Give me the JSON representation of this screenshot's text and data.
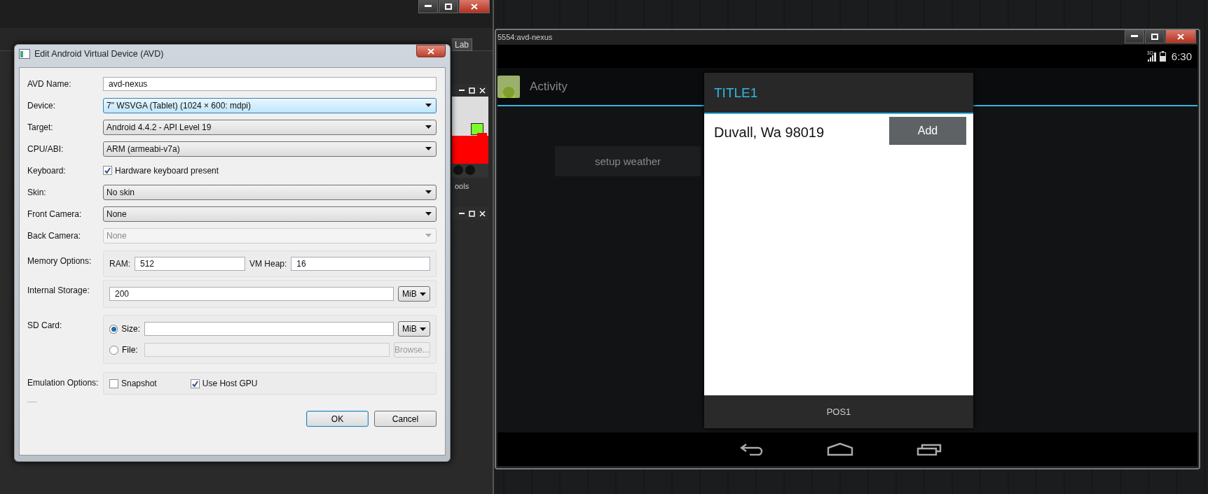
{
  "background_window": {
    "toolbar_button": "Lab",
    "panel_label": "ools"
  },
  "avd_dialog": {
    "title": "Edit Android Virtual Device (AVD)",
    "rows": [
      {
        "kind": "text",
        "label": "AVD Name:",
        "value": "avd-nexus"
      },
      {
        "kind": "select",
        "label": "Device:",
        "value": "7\" WSVGA (Tablet) (1024 × 600: mdpi)",
        "highlighted": true,
        "disabled": false
      },
      {
        "kind": "select",
        "label": "Target:",
        "value": "Android 4.4.2 - API Level 19",
        "highlighted": false,
        "disabled": false
      },
      {
        "kind": "select",
        "label": "CPU/ABI:",
        "value": "ARM (armeabi-v7a)",
        "highlighted": false,
        "disabled": false
      },
      {
        "kind": "checkbox",
        "label": "Keyboard:",
        "value": "Hardware keyboard present",
        "checked": true
      },
      {
        "kind": "select",
        "label": "Skin:",
        "value": "No skin",
        "highlighted": false,
        "disabled": false
      },
      {
        "kind": "select",
        "label": "Front Camera:",
        "value": "None",
        "highlighted": false,
        "disabled": false
      },
      {
        "kind": "select",
        "label": "Back Camera:",
        "value": "None",
        "highlighted": false,
        "disabled": true
      }
    ],
    "memory": {
      "label": "Memory Options:",
      "ram_label": "RAM:",
      "ram": "512",
      "heap_label": "VM Heap:",
      "heap": "16"
    },
    "internal_storage": {
      "label": "Internal Storage:",
      "value": "200",
      "unit": "MiB"
    },
    "sd_card": {
      "label": "SD Card:",
      "size_option": {
        "label": "Size:",
        "selected": true
      },
      "size_unit": "MiB",
      "file_option": {
        "label": "File:",
        "selected": false
      },
      "browse_button": {
        "label": "Browse...",
        "disabled": true
      }
    },
    "emulation": {
      "label": "Emulation Options:",
      "options": [
        {
          "label": "Snapshot",
          "checked": false
        },
        {
          "label": "Use Host GPU",
          "checked": true
        }
      ]
    },
    "buttons": [
      {
        "label": "OK",
        "default": true
      },
      {
        "label": "Cancel",
        "default": false
      }
    ]
  },
  "emulator": {
    "title": "5554:avd-nexus",
    "status_bar": {
      "network": "3G",
      "time": "6:30"
    },
    "action_bar": {
      "title": "Activity"
    },
    "setup_button": "setup weather",
    "dialog": {
      "title": "TITLE1",
      "location": "Duvall, Wa 98019",
      "add_button": "Add",
      "positive_button": "POS1"
    }
  }
}
